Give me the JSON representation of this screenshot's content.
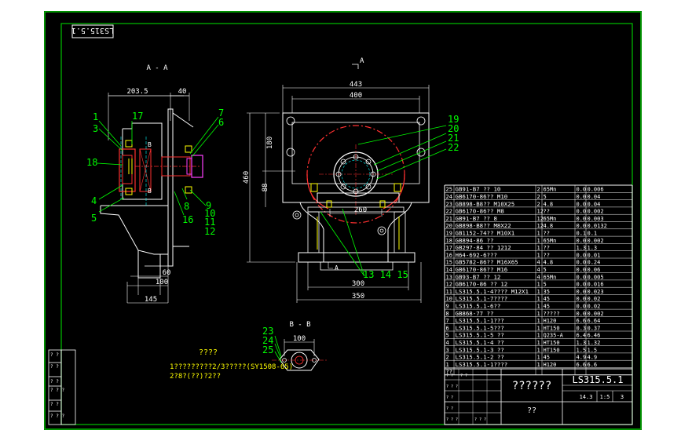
{
  "drawing": {
    "frame_code": "LS315.5.1",
    "section_aa": "A - A",
    "section_bb": "B - B",
    "view_arrow": "A",
    "dims_left": {
      "d1": "203.5",
      "d2": "40",
      "d3": "60",
      "d4": "100",
      "d5": "145"
    },
    "dims_mid": {
      "w_top": "443",
      "w_in": "400",
      "h1": "180",
      "h2": "460",
      "h3": "88",
      "w_mid": "260",
      "w_b1": "300",
      "w_b2": "350"
    },
    "dim_bb": "100",
    "callouts_left": [
      "1",
      "3",
      "17",
      "18",
      "4",
      "5",
      "7",
      "6",
      "8",
      "16",
      "9",
      "10",
      "11",
      "12"
    ],
    "callouts_mid": [
      "19",
      "20",
      "21",
      "22"
    ],
    "callouts_bottom": "13 14 15",
    "callouts_bb": [
      "23",
      "24",
      "25"
    ],
    "notes_title": "????",
    "notes": [
      "1?????????2/3?????(SY1508-65)",
      "2?8?(??)?2??"
    ]
  },
  "bom": [
    [
      "25",
      "GB91-B7 ?? 10",
      "2",
      "65Mn",
      "0.0",
      "0.006"
    ],
    [
      "24",
      "GB6170-86?? M10",
      "2",
      "5",
      "0.0",
      "0.04"
    ],
    [
      "23",
      "GB898-B8?? M10X25",
      "2",
      "4.8",
      "0.0",
      "0.04"
    ],
    [
      "22",
      "GB6170-86?? M8",
      "12",
      "??",
      "0.0",
      "0.002"
    ],
    [
      "21",
      "GB91-B7 ?? 8",
      "12",
      "65Mn",
      "0.0",
      "0.003"
    ],
    [
      "20",
      "GB898-B8?? M8X22",
      "12",
      "4.8",
      "0.0",
      "0.0132"
    ],
    [
      "19",
      "GB1152-74?? M10X1",
      "1",
      "??",
      "0.1",
      "0.1"
    ],
    [
      "18",
      "GB894-86 ??",
      "1",
      "65Mn",
      "0.0",
      "0.002"
    ],
    [
      "17",
      "GB297-84 ?? 1212",
      "1",
      "??",
      "1.3",
      "1.3"
    ],
    [
      "16",
      "H64-692-6???",
      "1",
      "??",
      "0.0",
      "0.01"
    ],
    [
      "15",
      "GB5782-86?? M16X65",
      "4",
      "4.8",
      "0.0",
      "0.24"
    ],
    [
      "14",
      "GB6170-86?? M16",
      "4",
      "5",
      "0.0",
      "0.06"
    ],
    [
      "13",
      "GB93-B7 ?? 12",
      "4",
      "65Mn",
      "0.0",
      "0.005"
    ],
    [
      "12",
      "GB6170-86 ?? 12",
      "1",
      "5",
      "0.0",
      "0.016"
    ],
    [
      "11",
      "LS315.5.1-4???? M12X1",
      "1",
      "35",
      "0.0",
      "0.023"
    ],
    [
      "10",
      "LS315.5.1-7????",
      "1",
      "45",
      "0.0",
      "0.02"
    ],
    [
      "9",
      "LS315.5.1-6??",
      "1",
      "45",
      "0.0",
      "0.02"
    ],
    [
      "8",
      "GB868-77 ??",
      "1",
      "?????",
      "0.0",
      "0.002"
    ],
    [
      "7",
      "LS315.5.1-1???",
      "1",
      "H120",
      "6.6",
      "6.64"
    ],
    [
      "6",
      "LS315.5.1-5???",
      "1",
      "HT150",
      "0.3",
      "0.37"
    ],
    [
      "5",
      "LS315.5.1-5 ??",
      "1",
      "Q235-A",
      "6.4",
      "6.46"
    ],
    [
      "4",
      "LS315.5.1-4 ??",
      "1",
      "HT150",
      "1.3",
      "1.32"
    ],
    [
      "3",
      "LS315.5.1-3 ??",
      "1",
      "HT150",
      "1.5",
      "1.5"
    ],
    [
      "2",
      "LS315.5.1-2 ??",
      "1",
      "45",
      "4.9",
      "4.9"
    ],
    [
      "1",
      "LS315.5.1-1????",
      "1",
      "H120",
      "6.6",
      "6.6"
    ],
    [
      "??",
      "",
      "",
      "",
      "",
      ""
    ]
  ],
  "title_block": {
    "title": "??????",
    "code": "LS315.5.1",
    "weight": "14.3",
    "scale": "1:5",
    "sheet": "3",
    "bottom_label": "??"
  }
}
